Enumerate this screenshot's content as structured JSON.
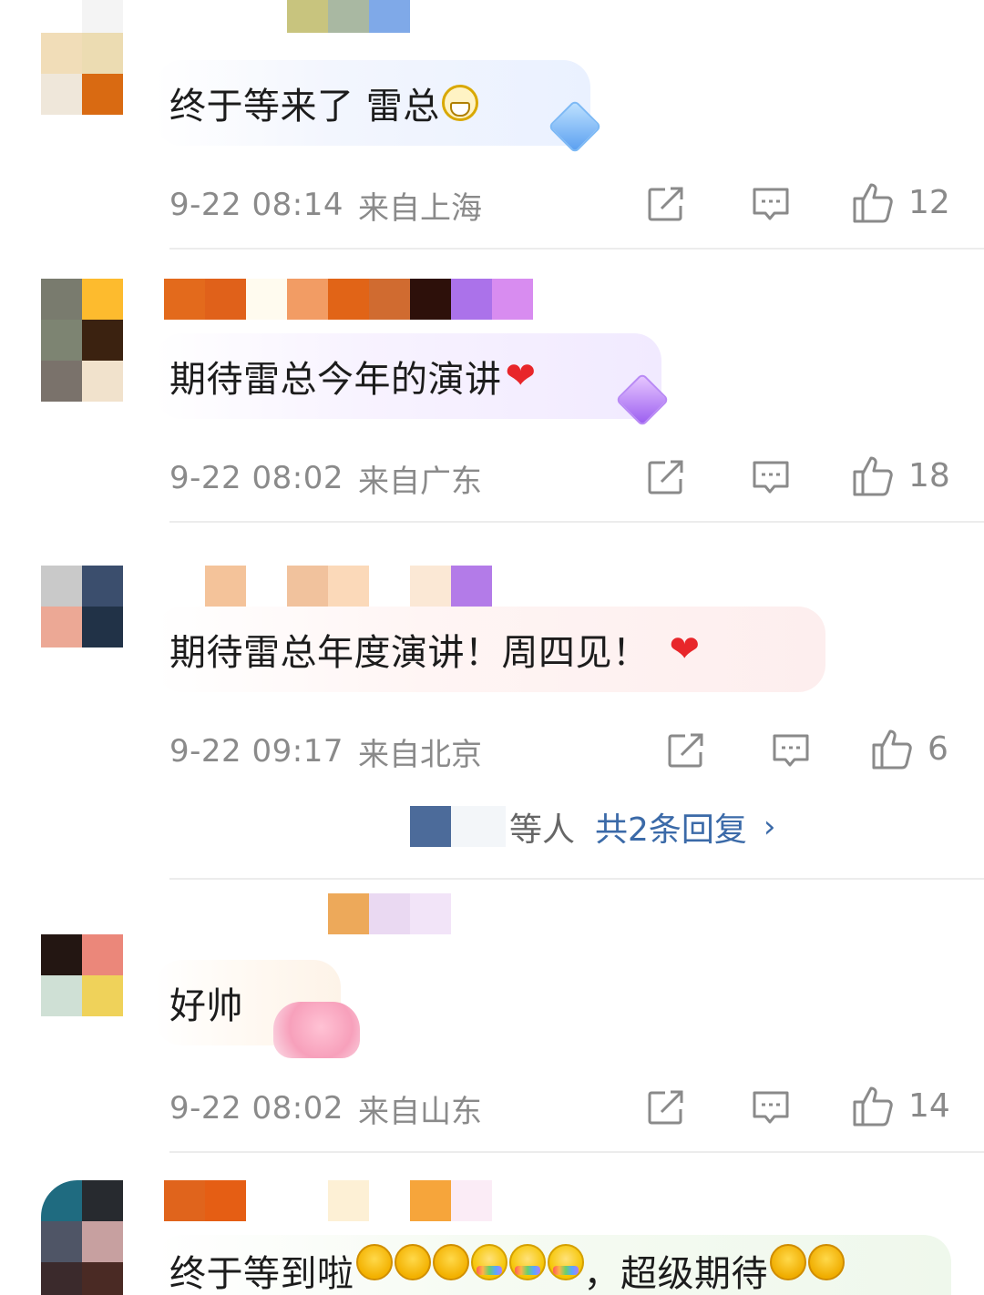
{
  "comments": [
    {
      "text": "终于等来了 雷总",
      "time": "9-22 08:14",
      "location": "来自上海",
      "likes": "12"
    },
    {
      "text": "期待雷总今年的演讲",
      "time": "9-22 08:02",
      "location": "来自广东",
      "likes": "18"
    },
    {
      "text": "期待雷总年度演讲！周四见！",
      "time": "9-22 09:17",
      "location": "来自北京",
      "likes": "6",
      "replies": {
        "who": "等人",
        "link": "共2条回复",
        "chevron": "›"
      }
    },
    {
      "text": "好帅",
      "time": "9-22 08:02",
      "location": "来自山东",
      "likes": "14"
    },
    {
      "text_a": "终于等到啦",
      "text_b": "，超级期待"
    }
  ],
  "icons": {
    "share": "share-icon",
    "comment": "comment-icon",
    "like": "thumbs-up-icon"
  },
  "colors": {
    "meta_gray": "#8a8a8a",
    "link_blue": "#3b6aa8",
    "heart_red": "#e8262a",
    "divider": "#ececec"
  }
}
